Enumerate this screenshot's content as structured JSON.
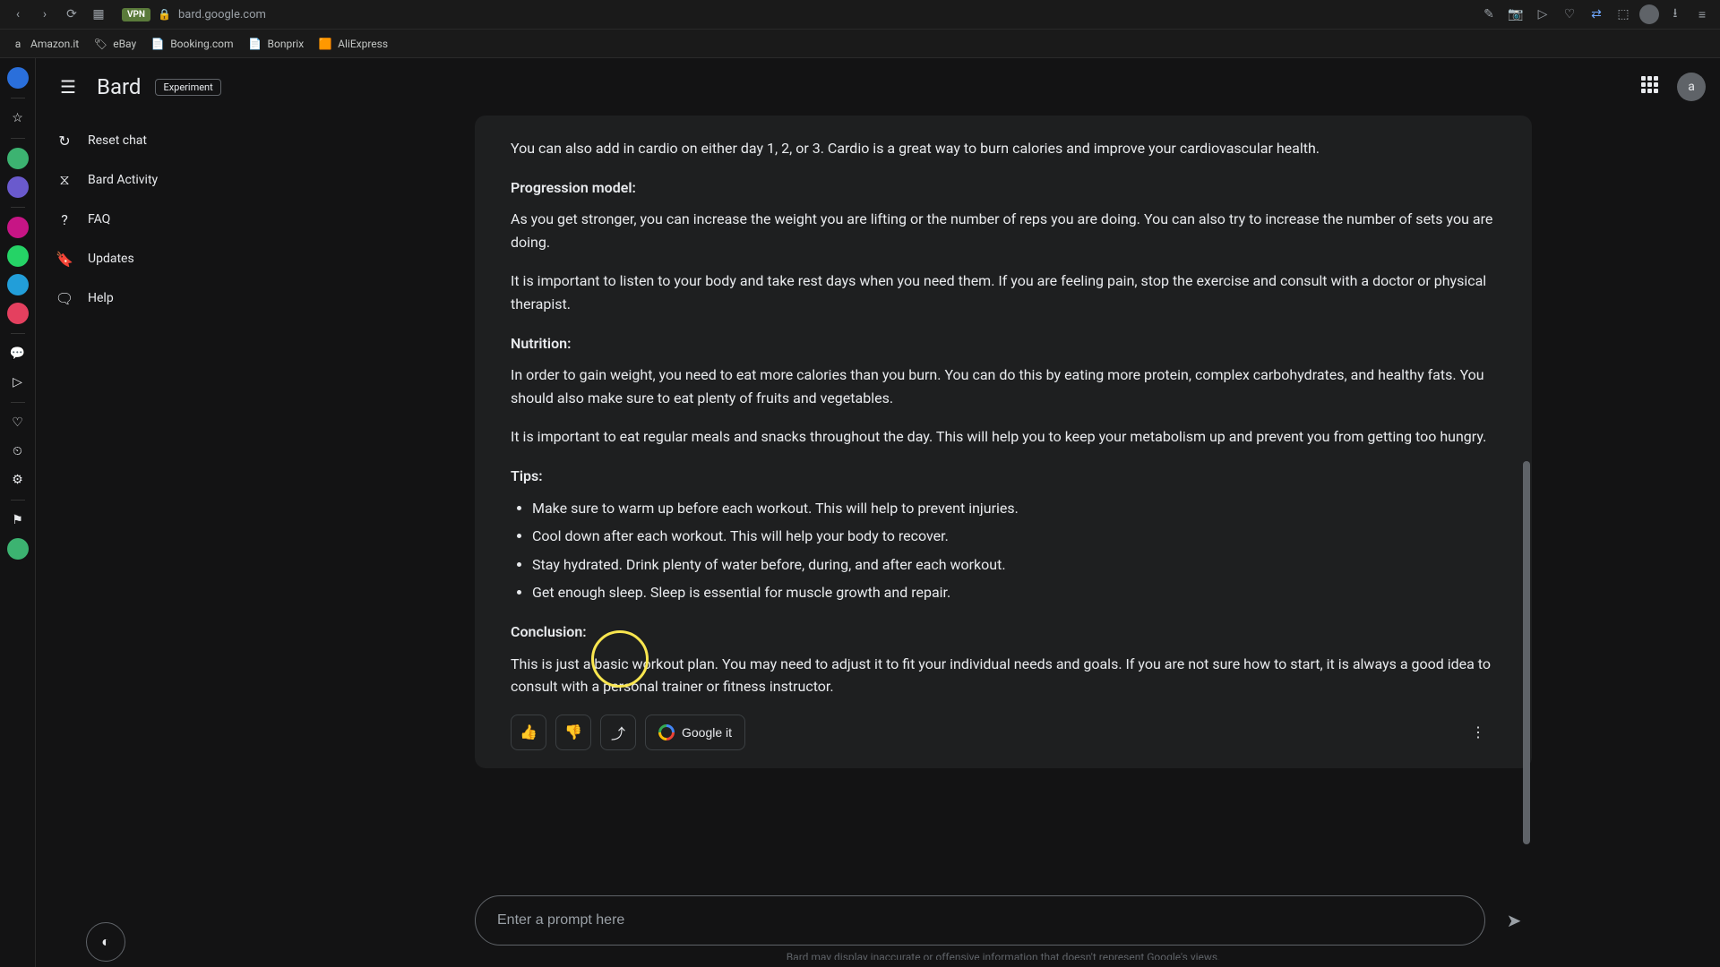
{
  "browser": {
    "url": "bard.google.com",
    "vpn": "VPN",
    "bookmarks": [
      {
        "label": "Amazon.it",
        "glyph": "a"
      },
      {
        "label": "eBay",
        "glyph": "🏷"
      },
      {
        "label": "Booking.com",
        "glyph": "📄"
      },
      {
        "label": "Bonprix",
        "glyph": "📄"
      },
      {
        "label": "AliExpress",
        "glyph": "🟧"
      }
    ],
    "avatar_letter": "a"
  },
  "app": {
    "brand": "Bard",
    "badge": "Experiment",
    "avatar_letter": "a"
  },
  "sidebar": {
    "items": [
      {
        "label": "Reset chat",
        "icon": "↻"
      },
      {
        "label": "Bard Activity",
        "icon": "⧖"
      },
      {
        "label": "FAQ",
        "icon": "?"
      },
      {
        "label": "Updates",
        "icon": "🔖"
      },
      {
        "label": "Help",
        "icon": "🗨"
      }
    ]
  },
  "response": {
    "p_cardio": "You can also add in cardio on either day 1, 2, or 3. Cardio is a great way to burn calories and improve your cardiovascular health.",
    "h_progression": "Progression model:",
    "p_progression1": "As you get stronger, you can increase the weight you are lifting or the number of reps you are doing. You can also try to increase the number of sets you are doing.",
    "p_progression2": "It is important to listen to your body and take rest days when you need them. If you are feeling pain, stop the exercise and consult with a doctor or physical therapist.",
    "h_nutrition": "Nutrition:",
    "p_nutrition1": "In order to gain weight, you need to eat more calories than you burn. You can do this by eating more protein, complex carbohydrates, and healthy fats. You should also make sure to eat plenty of fruits and vegetables.",
    "p_nutrition2": "It is important to eat regular meals and snacks throughout the day. This will help you to keep your metabolism up and prevent you from getting too hungry.",
    "h_tips": "Tips:",
    "tips": [
      "Make sure to warm up before each workout. This will help to prevent injuries.",
      "Cool down after each workout. This will help your body to recover.",
      "Stay hydrated. Drink plenty of water before, during, and after each workout.",
      "Get enough sleep. Sleep is essential for muscle growth and repair."
    ],
    "h_conclusion": "Conclusion:",
    "p_conclusion": "This is just a basic workout plan. You may need to adjust it to fit your individual needs and goals. If you are not sure how to start, it is always a good idea to consult with a personal trainer or fitness instructor.",
    "google_it": "Google it"
  },
  "prompt": {
    "placeholder": "Enter a prompt here"
  },
  "disclaimer": "Bard may display inaccurate or offensive information that doesn't represent Google's views.",
  "colors": {
    "bg": "#131314",
    "card": "#1e1f20",
    "border": "#5f6368",
    "text": "#e8eaed",
    "muted": "#9aa0a6",
    "highlight_ring": "#f9e64f"
  }
}
